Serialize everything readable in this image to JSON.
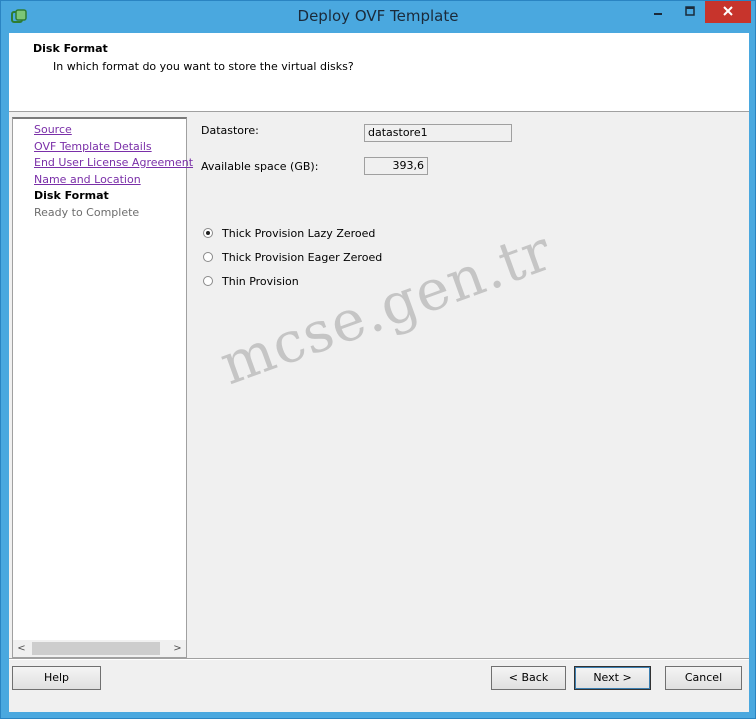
{
  "window": {
    "title": "Deploy OVF Template",
    "icon": "vsphere-deploy-icon",
    "controls": [
      "minimize-icon",
      "maximize-icon",
      "close-icon"
    ]
  },
  "header": {
    "title": "Disk Format",
    "subtitle": "In which format do you want to store the virtual disks?"
  },
  "nav": {
    "items": [
      {
        "label": "Source",
        "state": "link"
      },
      {
        "label": "OVF Template Details",
        "state": "link"
      },
      {
        "label": "End User License Agreement",
        "state": "link"
      },
      {
        "label": "Name and Location",
        "state": "link"
      },
      {
        "label": "Disk Format",
        "state": "current"
      },
      {
        "label": "Ready to Complete",
        "state": "pending"
      }
    ],
    "scroll_left": "<",
    "scroll_right": ">"
  },
  "form": {
    "datastore_label": "Datastore:",
    "datastore_value": "datastore1",
    "space_label": "Available space (GB):",
    "space_value": "393,6",
    "options": [
      {
        "label": "Thick Provision Lazy Zeroed",
        "selected": true
      },
      {
        "label": "Thick Provision Eager Zeroed",
        "selected": false
      },
      {
        "label": "Thin Provision",
        "selected": false
      }
    ]
  },
  "watermark": "mcse.gen.tr",
  "buttons": {
    "help": "Help",
    "back": "< Back",
    "next": "Next >",
    "cancel": "Cancel"
  },
  "colors": {
    "frame": "#4aa8df",
    "close_button": "#c7342c",
    "visited_link": "#7a2fa8"
  }
}
